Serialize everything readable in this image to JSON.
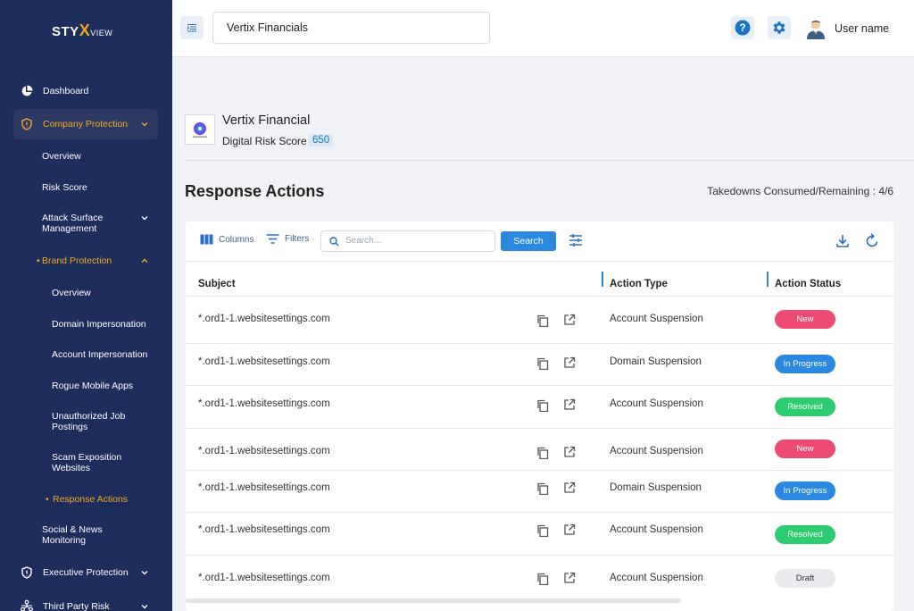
{
  "sidebar": {
    "logo": {
      "styx_a": "STY",
      "styx_x": "X",
      "view": "VIEW"
    },
    "items": {
      "dashboard": "Dashboard",
      "company_protection": "Company Protection",
      "overview": "Overview",
      "risk_score": "Risk Score",
      "attack_surface": "Attack Surface Management",
      "brand_protection": "Brand Protection",
      "brand_overview": "Overview",
      "domain_impersonation": "Domain Impersonation",
      "account_impersonation": "Account Impersonation",
      "rogue_mobile_apps": "Rogue Mobile Apps",
      "unauthorized_job": "Unauthorized Job Postings",
      "scam_exposition": "Scam Exposition Websites",
      "response_actions": "Response Actions",
      "social_news": "Social & News Monitoring",
      "executive_protection": "Executive Protection",
      "third_party_risk": "Third Party Risk"
    }
  },
  "topbar": {
    "org_value": "Vertix Financials",
    "user_name": "User name"
  },
  "company": {
    "name": "Vertix Financial",
    "risk_label": "Digital Risk Score",
    "risk_score": "650"
  },
  "page": {
    "title": "Response Actions",
    "takedowns": "Takedowns Consumed/Remaining : 4/6"
  },
  "toolbar": {
    "columns": "Columns",
    "filters": "Filters",
    "search_placeholder": "Search...",
    "search_button": "Search"
  },
  "table": {
    "headers": {
      "subject": "Subject",
      "action_type": "Action Type",
      "action_status": "Action Status"
    },
    "rows": [
      {
        "subject": "*.ord1-1.websitesettings.com",
        "action_type": "Account Suspension",
        "status": "New"
      },
      {
        "subject": "*.ord1-1.websitesettings.com",
        "action_type": "Domain Suspension",
        "status": "In Progress"
      },
      {
        "subject": "*.ord1-1.websitesettings.com",
        "action_type": "Account Suspension",
        "status": "Resolved"
      },
      {
        "subject": "*.ord1-1.websitesettings.com",
        "action_type": "Account Suspension",
        "status": "New"
      },
      {
        "subject": "*.ord1-1.websitesettings.com",
        "action_type": "Domain Suspension",
        "status": "In Progress"
      },
      {
        "subject": "*.ord1-1.websitesettings.com",
        "action_type": "Account Suspension",
        "status": "Resolved"
      },
      {
        "subject": "*.ord1-1.websitesettings.com",
        "action_type": "Account Suspension",
        "status": "Draft"
      }
    ]
  },
  "colors": {
    "sidebar_bg": "#1d2d5c",
    "accent_orange": "#f5a623",
    "primary_blue": "#2b88e0",
    "status_new": "#ee4b74",
    "status_in_progress": "#2b88e0",
    "status_resolved": "#2ecc71",
    "status_draft": "#e9ebef"
  }
}
